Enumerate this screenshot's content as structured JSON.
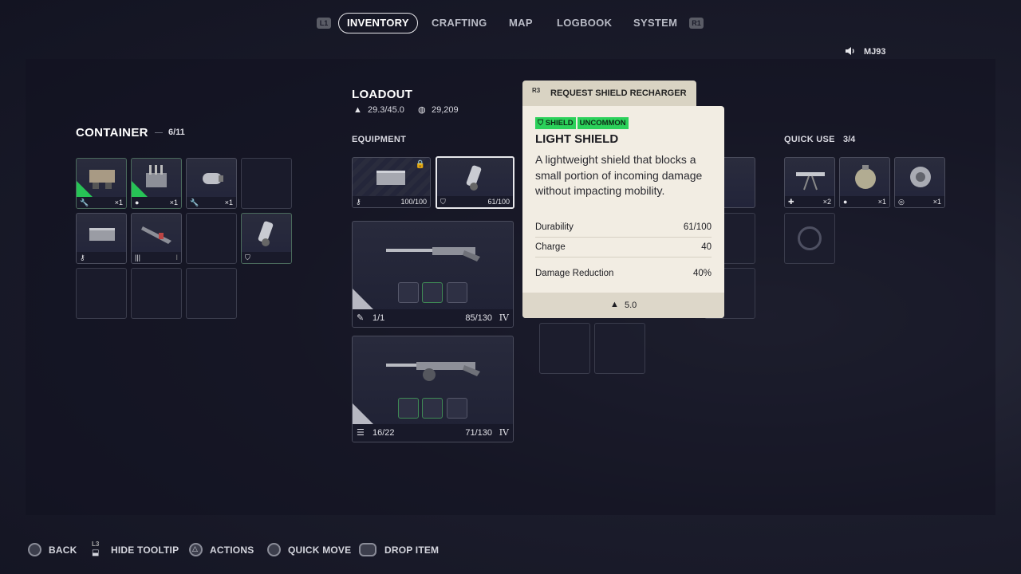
{
  "nav": {
    "left_bumper": "L1",
    "right_bumper": "R1",
    "tabs": [
      "INVENTORY",
      "CRAFTING",
      "MAP",
      "LOGBOOK",
      "SYSTEM"
    ],
    "active_tab": "INVENTORY"
  },
  "voice": {
    "username": "MJ93"
  },
  "container": {
    "title": "CONTAINER",
    "count": "6/11",
    "slots": [
      {
        "qty": "×1",
        "icon": "wrench-icon"
      },
      {
        "qty": "×1",
        "icon": "grenade-icon"
      },
      {
        "qty": "×1",
        "icon": "wrench-icon"
      },
      {
        "qty": "",
        "icon": ""
      },
      {
        "qty": "",
        "icon": "key-icon"
      },
      {
        "qty": "",
        "icon": "ammo-icon",
        "tier": "I"
      },
      {
        "qty": "",
        "icon": ""
      },
      {
        "qty": "",
        "icon": "shield-icon"
      }
    ]
  },
  "loadout": {
    "title": "LOADOUT",
    "weight": "29.3/45.0",
    "currency": "29,209",
    "equipment_label": "EQUIPMENT",
    "augment_durability": "100/100",
    "shield_durability": "61/100",
    "weapon1": {
      "ammo": "1/1",
      "durability": "85/130",
      "tier": "IV"
    },
    "weapon2": {
      "ammo": "16/22",
      "durability": "71/130",
      "tier": "IV"
    }
  },
  "quick_use": {
    "label": "QUICK USE",
    "count": "3/4",
    "slots": [
      {
        "qty": "×2",
        "icon": "medkit-icon"
      },
      {
        "qty": "×1",
        "icon": "grenade-icon"
      },
      {
        "qty": "×1",
        "icon": "target-icon"
      }
    ]
  },
  "tooltip": {
    "action_button": "R3",
    "action_label": "REQUEST SHIELD RECHARGER",
    "tags": [
      "SHIELD",
      "UNCOMMON"
    ],
    "name": "LIGHT SHIELD",
    "description": "A lightweight shield that blocks a small portion of incoming damage without impacting mobility.",
    "stats": [
      {
        "label": "Durability",
        "value": "61/100"
      },
      {
        "label": "Charge",
        "value": "40"
      },
      {
        "label": "Damage Reduction",
        "value": "40%"
      }
    ],
    "weight": "5.0"
  },
  "footer_hints": [
    {
      "button": "circle",
      "label": "BACK"
    },
    {
      "button": "L3",
      "label": "HIDE TOOLTIP"
    },
    {
      "button": "triangle",
      "label": "ACTIONS"
    },
    {
      "button": "square",
      "label": "QUICK MOVE"
    },
    {
      "button": "touchpad",
      "label": "DROP ITEM"
    }
  ],
  "colors": {
    "rarity_uncommon": "#2bd15a",
    "tooltip_bg": "#f2ede3",
    "background": "#1b1c2b"
  }
}
